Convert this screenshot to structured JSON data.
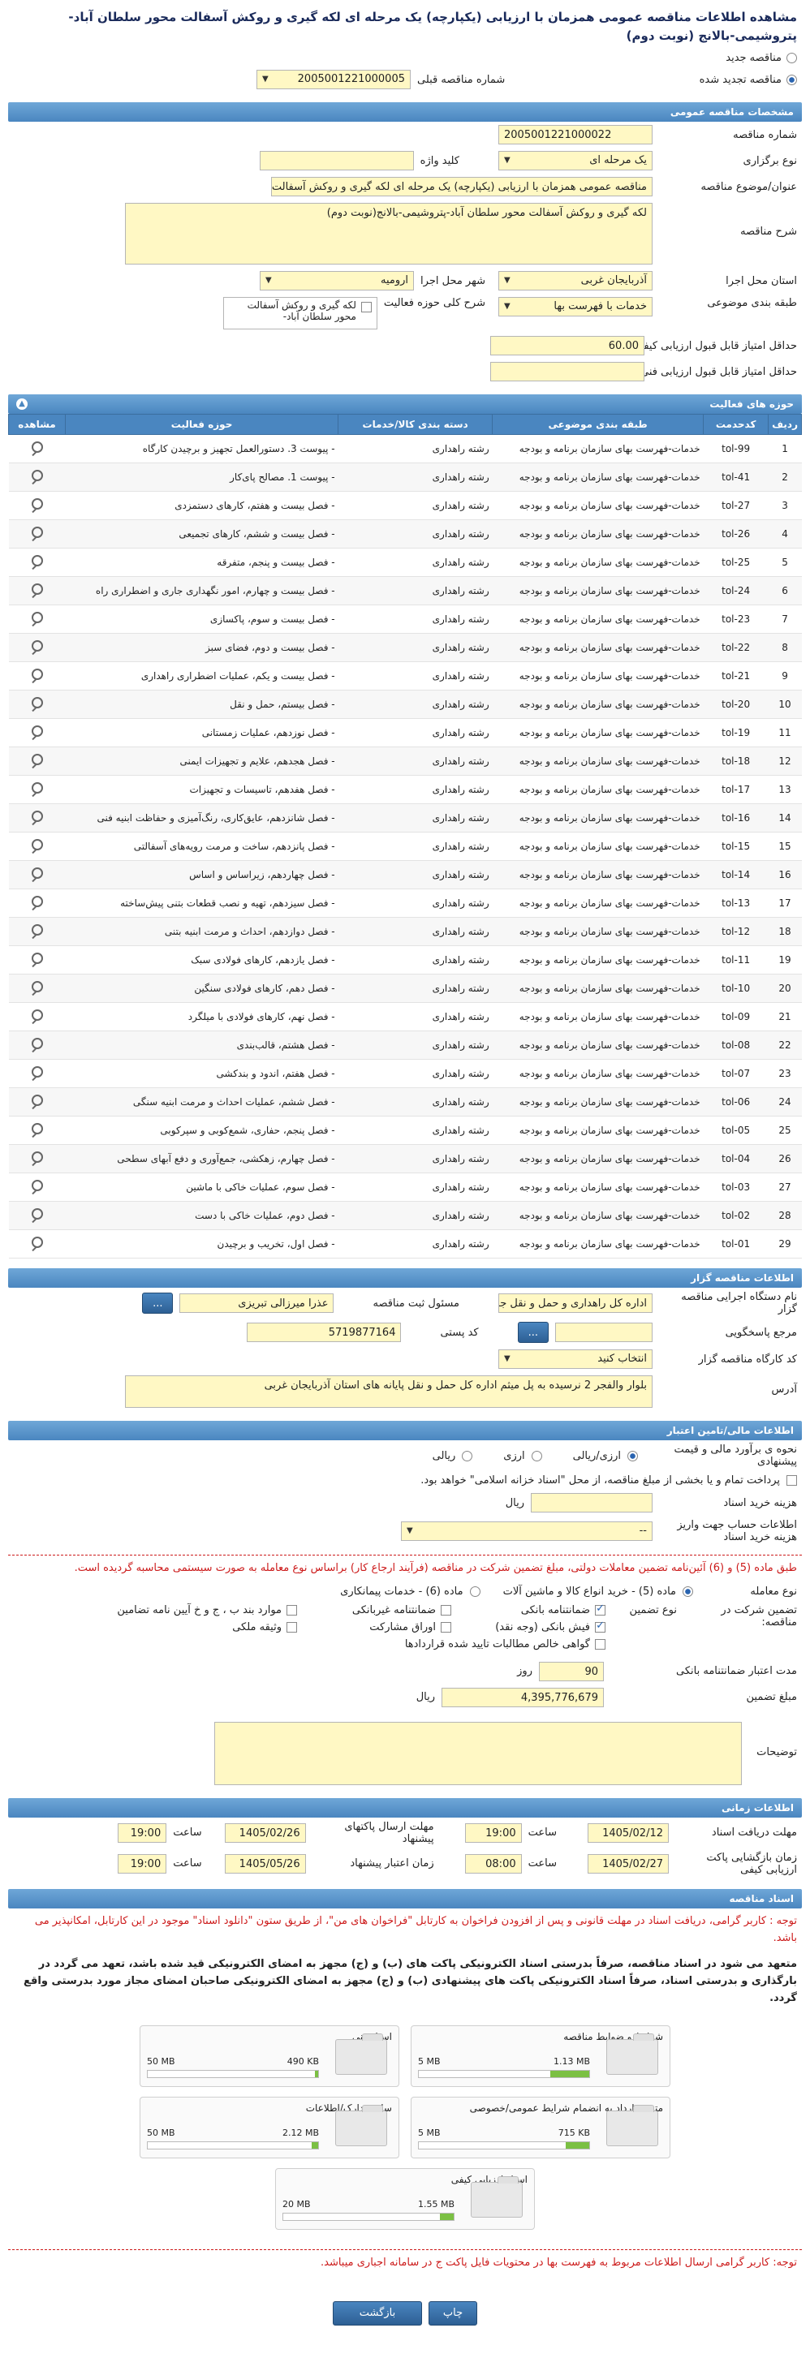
{
  "title": "مشاهده اطلاعات مناقصه عمومی همزمان با ارزیابی (یکپارچه) یک مرحله ای لکه گیری و روکش آسفالت محور سلطان آباد-پتروشیمی-بالانج (نوبت دوم)",
  "top": {
    "new_tender": "مناقصه جدید",
    "renewed_tender": "مناقصه تجدید شده",
    "prev_number_label": "شماره مناقصه قبلی",
    "prev_number_value": "2005001221000005"
  },
  "general": {
    "header": "مشخصات مناقصه عمومی",
    "number_label": "شماره مناقصه",
    "number_value": "2005001221000022",
    "holding_label": "نوع برگزاری",
    "holding_value": "یک مرحله ای",
    "keyword_label": "کلید واژه",
    "keyword_value": "",
    "subject_label": "عنوان/موضوع مناقصه",
    "subject_value": "مناقصه عمومی همزمان با ارزیابی (یکپارچه) یک مرحله ای لکه گیری و روکش آسفالت محور سلطان آباد-پتروشیمی-بالانج (نوبت دوم)",
    "desc_label": "شرح مناقصه",
    "desc_value": "لکه گیری و روکش آسفالت محور سلطان آباد-پتروشیمی-بالانج(نوبت دوم)",
    "province_label": "استان محل اجرا",
    "province_value": "آذربایجان غربی",
    "city_label": "شهر محل اجرا",
    "city_value": "ارومیه",
    "category_label": "طبقه بندی موضوعی",
    "category_value": "خدمات با فهرست بها",
    "activity_label": "شرح کلی حوزه فعالیت",
    "activity_value": "لکه گیری و روکش آسفالت محور سلطان آباد-",
    "min_quality_label": "حداقل امتیاز قابل قبول ارزیابی کیفی",
    "min_quality_value": "60.00",
    "min_tech_label": "حداقل امتیاز قابل قبول ارزیابی فنی/بازرگانی",
    "min_tech_value": ""
  },
  "activities": {
    "header": "حوزه های فعالیت",
    "columns": [
      "ردیف",
      "کدحدمت",
      "طبقه بندی موضوعی",
      "دسته بندی کالا/خدمات",
      "حوزه فعالیت",
      "مشاهده"
    ],
    "rows": [
      {
        "idx": "1",
        "code": "tol-99",
        "cat": "خدمات-فهرست بهای سازمان برنامه و بودجه",
        "group": "رشته راهداری",
        "field": "- پیوست 3. دستورالعمل تجهیز و برچیدن کارگاه"
      },
      {
        "idx": "2",
        "code": "tol-41",
        "cat": "خدمات-فهرست بهای سازمان برنامه و بودجه",
        "group": "رشته راهداری",
        "field": "- پیوست 1. مصالح پای‌کار"
      },
      {
        "idx": "3",
        "code": "tol-27",
        "cat": "خدمات-فهرست بهای سازمان برنامه و بودجه",
        "group": "رشته راهداری",
        "field": "- فصل بیست و هفتم، کارهای دستمزدی"
      },
      {
        "idx": "4",
        "code": "tol-26",
        "cat": "خدمات-فهرست بهای سازمان برنامه و بودجه",
        "group": "رشته راهداری",
        "field": "- فصل بیست و ششم، کارهای تجمیعی"
      },
      {
        "idx": "5",
        "code": "tol-25",
        "cat": "خدمات-فهرست بهای سازمان برنامه و بودجه",
        "group": "رشته راهداری",
        "field": "- فصل بیست و پنجم، متفرقه"
      },
      {
        "idx": "6",
        "code": "tol-24",
        "cat": "خدمات-فهرست بهای سازمان برنامه و بودجه",
        "group": "رشته راهداری",
        "field": "- فصل بیست و چهارم، امور نگهداری جاری و اضطراری راه"
      },
      {
        "idx": "7",
        "code": "tol-23",
        "cat": "خدمات-فهرست بهای سازمان برنامه و بودجه",
        "group": "رشته راهداری",
        "field": "- فصل بیست و سوم، پاکسازی"
      },
      {
        "idx": "8",
        "code": "tol-22",
        "cat": "خدمات-فهرست بهای سازمان برنامه و بودجه",
        "group": "رشته راهداری",
        "field": "- فصل بیست و دوم، فضای سبز"
      },
      {
        "idx": "9",
        "code": "tol-21",
        "cat": "خدمات-فهرست بهای سازمان برنامه و بودجه",
        "group": "رشته راهداری",
        "field": "- فصل بیست و یکم، عملیات اضطراری راهداری"
      },
      {
        "idx": "10",
        "code": "tol-20",
        "cat": "خدمات-فهرست بهای سازمان برنامه و بودجه",
        "group": "رشته راهداری",
        "field": "- فصل بیستم، حمل و نقل"
      },
      {
        "idx": "11",
        "code": "tol-19",
        "cat": "خدمات-فهرست بهای سازمان برنامه و بودجه",
        "group": "رشته راهداری",
        "field": "- فصل نوزدهم، عملیات زمستانی"
      },
      {
        "idx": "12",
        "code": "tol-18",
        "cat": "خدمات-فهرست بهای سازمان برنامه و بودجه",
        "group": "رشته راهداری",
        "field": "- فصل هجدهم، علایم و تجهیزات ایمنی"
      },
      {
        "idx": "13",
        "code": "tol-17",
        "cat": "خدمات-فهرست بهای سازمان برنامه و بودجه",
        "group": "رشته راهداری",
        "field": "- فصل هفدهم، تاسیسات و تجهیزات"
      },
      {
        "idx": "14",
        "code": "tol-16",
        "cat": "خدمات-فهرست بهای سازمان برنامه و بودجه",
        "group": "رشته راهداری",
        "field": "- فصل شانزدهم، عایق‌کاری، رنگ‌آمیزی و حفاظت ابنیه فنی"
      },
      {
        "idx": "15",
        "code": "tol-15",
        "cat": "خدمات-فهرست بهای سازمان برنامه و بودجه",
        "group": "رشته راهداری",
        "field": "- فصل پانزدهم، ساخت و مرمت رویه‌های آسفالتی"
      },
      {
        "idx": "16",
        "code": "tol-14",
        "cat": "خدمات-فهرست بهای سازمان برنامه و بودجه",
        "group": "رشته راهداری",
        "field": "- فصل چهاردهم، زیراساس و اساس"
      },
      {
        "idx": "17",
        "code": "tol-13",
        "cat": "خدمات-فهرست بهای سازمان برنامه و بودجه",
        "group": "رشته راهداری",
        "field": "- فصل سیزدهم، تهیه و نصب قطعات بتنی پیش‌ساخته"
      },
      {
        "idx": "18",
        "code": "tol-12",
        "cat": "خدمات-فهرست بهای سازمان برنامه و بودجه",
        "group": "رشته راهداری",
        "field": "- فصل دوازدهم، احداث و مرمت ابنیه بتنی"
      },
      {
        "idx": "19",
        "code": "tol-11",
        "cat": "خدمات-فهرست بهای سازمان برنامه و بودجه",
        "group": "رشته راهداری",
        "field": "- فصل یازدهم، کارهای فولادی سبک"
      },
      {
        "idx": "20",
        "code": "tol-10",
        "cat": "خدمات-فهرست بهای سازمان برنامه و بودجه",
        "group": "رشته راهداری",
        "field": "- فصل دهم، کارهای فولادی سنگین"
      },
      {
        "idx": "21",
        "code": "tol-09",
        "cat": "خدمات-فهرست بهای سازمان برنامه و بودجه",
        "group": "رشته راهداری",
        "field": "- فصل نهم، کارهای فولادی با میلگرد"
      },
      {
        "idx": "22",
        "code": "tol-08",
        "cat": "خدمات-فهرست بهای سازمان برنامه و بودجه",
        "group": "رشته راهداری",
        "field": "- فصل هشتم، قالب‌بندی"
      },
      {
        "idx": "23",
        "code": "tol-07",
        "cat": "خدمات-فهرست بهای سازمان برنامه و بودجه",
        "group": "رشته راهداری",
        "field": "- فصل هفتم، اندود و بندکشی"
      },
      {
        "idx": "24",
        "code": "tol-06",
        "cat": "خدمات-فهرست بهای سازمان برنامه و بودجه",
        "group": "رشته راهداری",
        "field": "- فصل ششم، عملیات احداث و مرمت ابنیه سنگی"
      },
      {
        "idx": "25",
        "code": "tol-05",
        "cat": "خدمات-فهرست بهای سازمان برنامه و بودجه",
        "group": "رشته راهداری",
        "field": "- فصل پنجم، حفاری، شمع‌کوبی و سپرکوبی"
      },
      {
        "idx": "26",
        "code": "tol-04",
        "cat": "خدمات-فهرست بهای سازمان برنامه و بودجه",
        "group": "رشته راهداری",
        "field": "- فصل چهارم، زهکشی، جمع‌آوری و دفع آبهای سطحی"
      },
      {
        "idx": "27",
        "code": "tol-03",
        "cat": "خدمات-فهرست بهای سازمان برنامه و بودجه",
        "group": "رشته راهداری",
        "field": "- فصل سوم، عملیات خاکی با ماشین"
      },
      {
        "idx": "28",
        "code": "tol-02",
        "cat": "خدمات-فهرست بهای سازمان برنامه و بودجه",
        "group": "رشته راهداری",
        "field": "- فصل دوم، عملیات خاکی با دست"
      },
      {
        "idx": "29",
        "code": "tol-01",
        "cat": "خدمات-فهرست بهای سازمان برنامه و بودجه",
        "group": "رشته راهداری",
        "field": "- فصل اول، تخریب و برچیدن"
      }
    ]
  },
  "organizer": {
    "header": "اطلاعات مناقصه گزار",
    "device_label": "نام دستگاه اجرایی مناقصه گزار",
    "device_value": "اداره کل راهداری و حمل و نقل جاده ای استان آذربایجان غربی",
    "registrar_label": "مسئول ثبت مناقصه",
    "registrar_value": "عذرا میرزالی تبریزی",
    "more_btn": "...",
    "reference_label": "مرجع پاسخگویی",
    "reference_value": "",
    "postal_label": "کد پستی",
    "postal_value": "5719877164",
    "workshop_label": "کد کارگاه مناقصه گزار",
    "workshop_value": "انتخاب کنید",
    "address_label": "آدرس",
    "address_value": "بلوار والفجر 2 نرسیده به پل میثم اداره کل حمل و نقل پایانه های استان آذربایجان غربی"
  },
  "financial": {
    "header": "اطلاعات مالی/تامین اعتبار",
    "estimate_label": "نحوه ی برآورد مالی و قیمت پیشنهادی",
    "currency_label": "ارزی/ریالی",
    "foreign_label": "ارزی",
    "rial_label": "ریالی",
    "treasury_text": "پرداخت تمام و یا بخشی از مبلغ مناقصه، از محل \"اسناد خزانه اسلامی\" خواهد بود.",
    "doc_cost_label": "هزینه خرید اسناد",
    "doc_cost_unit": "ریال",
    "account_label": "اطلاعات حساب جهت واریز هزینه خرید اسناد",
    "account_value": "--",
    "red_note": "طبق ماده (5) و (6) آئین‌نامه تضمین معاملات دولتی، مبلغ تضمین شرکت در مناقصه (فرآیند ارجاع کار) براساس نوع معامله به صورت سیستمی محاسبه گردیده است.",
    "deal_type_label": "نوع معامله",
    "deal_type_1": "ماده (5) - خرید انواع کالا و ماشین آلات",
    "deal_type_2": "ماده (6) - خدمات پیمانکاری",
    "guarantee_label": "تضمین شرکت در مناقصه:",
    "guarantee_type_label": "نوع تضمین",
    "g_bank": "ضمانتنامه بانکی",
    "g_nonbank": "ضمانتنامه غیربانکی",
    "g_other": "موارد بند ب ، ج و خ آیین نامه تضامین",
    "g_cheque": "فیش بانکی (وجه نقد)",
    "g_bonds": "اوراق مشارکت",
    "g_property": "وثیقه ملکی",
    "g_receivables": "گواهی خالص مطالبات تایید شده قراردادها",
    "validity_label": "مدت اعتبار ضمانتنامه بانکی",
    "validity_value": "90",
    "validity_unit": "روز",
    "amount_label": "مبلغ تضمین",
    "amount_value": "4,395,776,679",
    "amount_unit": "ریال",
    "notes_label": "توضیحات",
    "notes_value": ""
  },
  "timing": {
    "header": "اطلاعات زمانی",
    "doc_receive_label": "مهلت دریافت اسناد",
    "doc_receive_date": "1405/02/12",
    "doc_receive_time": "19:00",
    "time_label": "ساعت",
    "send_offer_label": "مهلت ارسال پاکتهای پیشنهاد",
    "send_offer_date": "1405/02/26",
    "send_offer_time": "19:00",
    "opening_label": "زمان بازگشایی پاکت ارزیابی کیفی",
    "opening_date": "1405/02/27",
    "opening_time": "08:00",
    "validity_label": "زمان اعتبار پیشنهاد",
    "validity_date": "1405/05/26",
    "validity_time": "19:00"
  },
  "documents": {
    "header": "اسناد مناقصه",
    "note_red": "توجه : کاربر گرامی، دریافت اسناد در مهلت قانونی و پس از افزودن فراخوان به کارتابل \"فراخوان های من\"، از طریق ستون \"دانلود اسناد\" موجود در این کارتابل، امکانپذیر می باشد.",
    "note_bold": "متعهد می شود در اسناد مناقصه، صرفاً بدرستی اسناد الکترونیکی پاکت های (ب) و (ج) مجهز به امضای الکترونیکی قید شده باشد، تعهد می گردد در بارگذاری و بدرستی اسناد، صرفاً اسناد الکترونیکی پاکت های پیشنهادی (ب) و (ج) مجهز به امضای الکترونیکی صاحبان امضای مجاز مورد بدرستی واقع گردد.",
    "files": [
      {
        "name": "شرایط و ضوابط مناقصه",
        "size": "1.13 MB",
        "max": "5 MB",
        "fill": 0.23
      },
      {
        "name": "اسناد فنی",
        "size": "490 KB",
        "max": "50 MB",
        "fill": 0.01
      },
      {
        "name": "متن قرارداد به انضمام شرایط عمومی/خصوصی",
        "size": "715 KB",
        "max": "5 MB",
        "fill": 0.14
      },
      {
        "name": "سایر مدارک/اطلاعات",
        "size": "2.12 MB",
        "max": "50 MB",
        "fill": 0.04
      },
      {
        "name": "اسناد ارزیابی کیفی",
        "size": "1.55 MB",
        "max": "20 MB",
        "fill": 0.08
      }
    ],
    "footer_note": "توجه: کاربر گرامی ارسال اطلاعات مربوط به فهرست بها در محتویات فایل پاکت ج در سامانه اجباری میباشد."
  },
  "buttons": {
    "print": "چاپ",
    "back": "بازگشت"
  }
}
